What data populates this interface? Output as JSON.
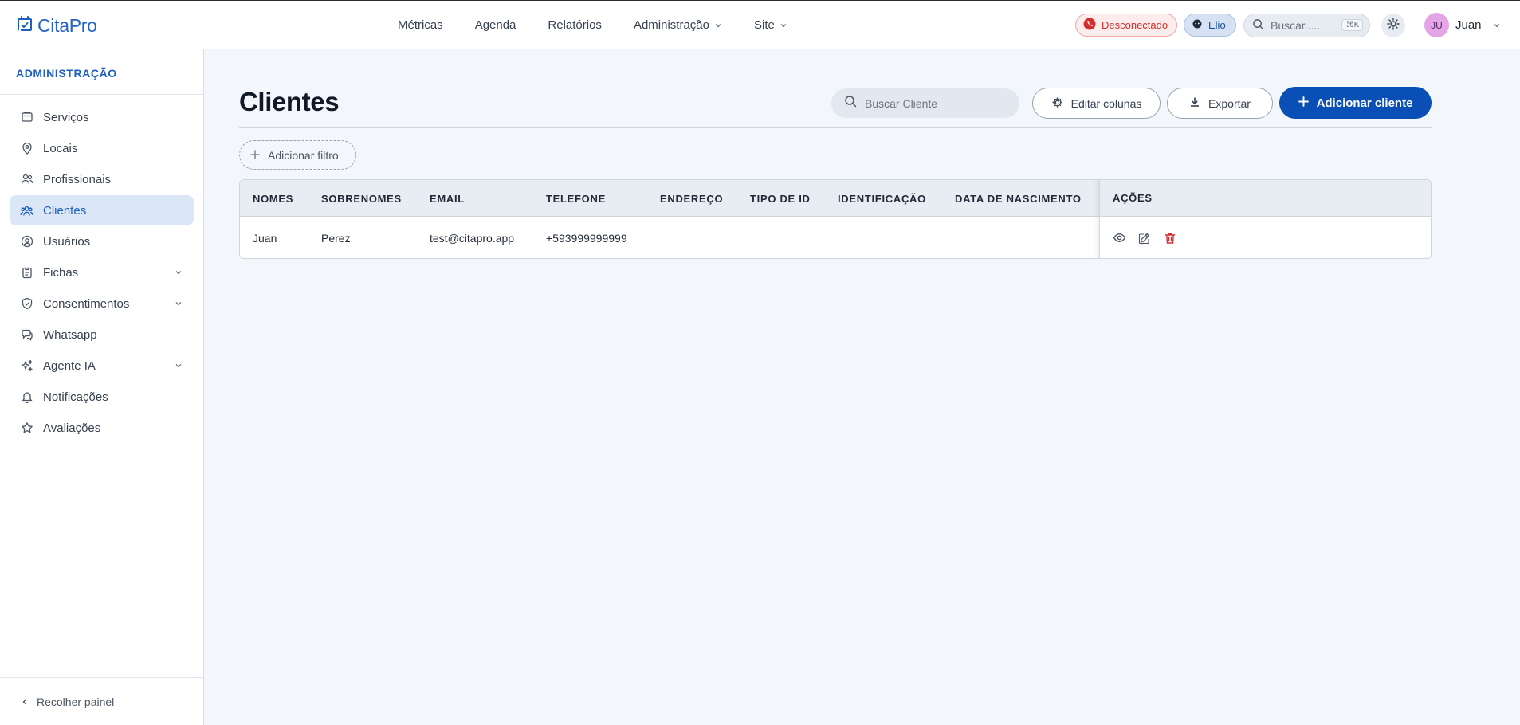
{
  "app": {
    "logo_text": "CitaPro"
  },
  "topnav": {
    "items": [
      {
        "label": "Métricas",
        "dropdown": false
      },
      {
        "label": "Agenda",
        "dropdown": false
      },
      {
        "label": "Relatórios",
        "dropdown": false
      },
      {
        "label": "Administração",
        "dropdown": true
      },
      {
        "label": "Site",
        "dropdown": true
      }
    ],
    "whatsapp_status": "Desconectado",
    "agent_badge": "Elio",
    "search_placeholder": "Buscar......",
    "search_shortcut": "⌘K",
    "user_initials": "JU",
    "user_name": "Juan"
  },
  "sidebar": {
    "title": "ADMINISTRAÇÃO",
    "items": [
      {
        "label": "Serviços",
        "icon": "box-icon",
        "expandable": false,
        "active": false
      },
      {
        "label": "Locais",
        "icon": "map-pin-icon",
        "expandable": false,
        "active": false
      },
      {
        "label": "Profissionais",
        "icon": "users-icon",
        "expandable": false,
        "active": false
      },
      {
        "label": "Clientes",
        "icon": "user-group-icon",
        "expandable": false,
        "active": true
      },
      {
        "label": "Usuários",
        "icon": "user-circle-icon",
        "expandable": false,
        "active": false
      },
      {
        "label": "Fichas",
        "icon": "clipboard-icon",
        "expandable": true,
        "active": false
      },
      {
        "label": "Consentimentos",
        "icon": "shield-check-icon",
        "expandable": true,
        "active": false
      },
      {
        "label": "Whatsapp",
        "icon": "chat-icon",
        "expandable": false,
        "active": false
      },
      {
        "label": "Agente IA",
        "icon": "sparkles-icon",
        "expandable": true,
        "active": false
      },
      {
        "label": "Notificações",
        "icon": "bell-icon",
        "expandable": false,
        "active": false
      },
      {
        "label": "Avaliações",
        "icon": "star-icon",
        "expandable": false,
        "active": false
      }
    ],
    "collapse_label": "Recolher painel"
  },
  "main": {
    "title": "Clientes",
    "search_placeholder": "Buscar Cliente",
    "edit_columns_label": "Editar colunas",
    "export_label": "Exportar",
    "add_client_label": "Adicionar cliente",
    "add_filter_label": "Adicionar filtro"
  },
  "table": {
    "columns": [
      "NOMES",
      "SOBRENOMES",
      "EMAIL",
      "TELEFONE",
      "ENDEREÇO",
      "TIPO DE ID",
      "IDENTIFICAÇÃO",
      "DATA DE NASCIMENTO"
    ],
    "actions_header": "AÇÕES",
    "rows": [
      {
        "cells": [
          "Juan",
          "Perez",
          "test@citapro.app",
          "+593999999999",
          "",
          "",
          "",
          ""
        ]
      }
    ]
  },
  "colors": {
    "primary": "#0a4fb5",
    "active_bg": "#dbe7f7",
    "danger": "#d32f2f"
  }
}
